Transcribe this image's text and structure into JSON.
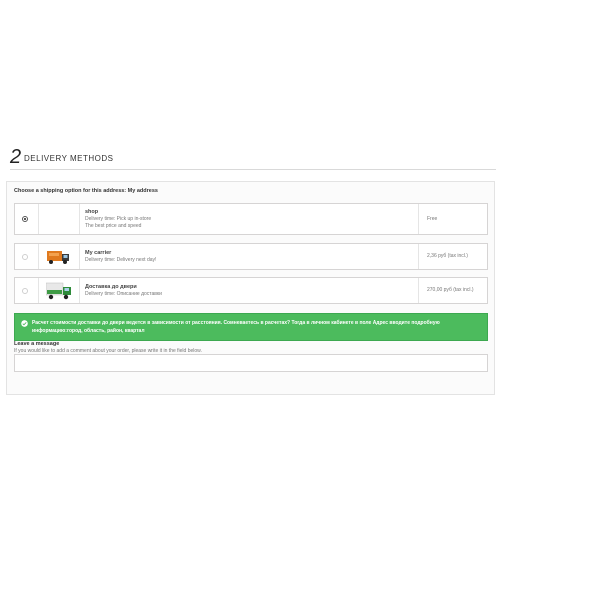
{
  "step": {
    "number": "2",
    "title": "DELIVERY METHODS"
  },
  "shipping": {
    "choose_label": "Choose a shipping option for this address: My address",
    "carriers": [
      {
        "name": "shop",
        "lines": [
          "Delivery time: Pick up in-store",
          "The best price and speed"
        ],
        "price": "Free",
        "selected": true,
        "logo_icon": ""
      },
      {
        "name": "My carrier",
        "lines": [
          "Delivery time: Delivery next day!"
        ],
        "price": "2,36 руб (tax incl.)",
        "selected": false,
        "logo_icon": "orange-truck-icon"
      },
      {
        "name": "Доставка до двери",
        "lines": [
          "Delivery time: Описание доставки"
        ],
        "price": "270,00 руб (tax incl.)",
        "selected": false,
        "logo_icon": "green-truck-icon"
      }
    ]
  },
  "alert": {
    "text": "Расчет стоимости доставки до двери ведется в зависимости от расстояния. Сомневаетесь в расчетах? Тогда в личном кабинете в поле Адрес вводите подробную информацию:город, область, район, квартал",
    "icon": "check-circle-icon",
    "color": "#4cbb5d"
  },
  "message": {
    "title": "Leave a message",
    "hint": "If you would like to add a comment about your order, please write it in the field below.",
    "value": ""
  }
}
